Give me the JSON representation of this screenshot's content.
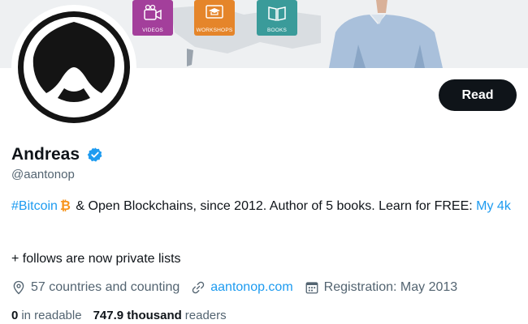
{
  "banner": {
    "tiles": [
      "VIDEOS",
      "WORKSHOPS",
      "BOOKS"
    ],
    "colors": {
      "videos": "#a33f9b",
      "workshops": "#e5852a",
      "books": "#3a9b9a"
    }
  },
  "profile": {
    "name": "Andreas",
    "handle": "@aantonop",
    "verified": true
  },
  "read_button": "Read",
  "bio": {
    "hashtag": "#Bitcoin",
    "icon": "bitcoin-icon",
    "text": " & Open Blockchains, since 2012. Author of 5 books. Learn for FREE:",
    "link": "My 4k"
  },
  "extra_line": "+ follows are now private lists",
  "meta": {
    "location": "57 countries and counting",
    "website": "aantonop.com",
    "joined": "Registration: May 2013"
  },
  "stats": {
    "following_count": "0",
    "following_label": "in readable",
    "followers_count": "747.9 thousand",
    "followers_label": "readers"
  },
  "colors": {
    "accent": "#1d9bf0",
    "text": "#0f1419",
    "muted": "#536471",
    "bitcoin": "#f7931a"
  }
}
